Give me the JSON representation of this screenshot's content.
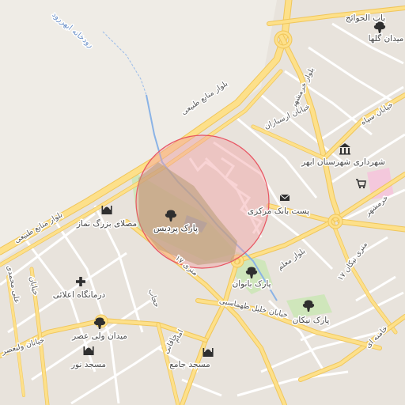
{
  "map": {
    "highlight_fill": "#f1a0a2",
    "highlight_stroke": "#e85562",
    "road_color": "#fde08a",
    "road_casing": "#f0c65a",
    "park_color": "#cfe6bb",
    "water_color": "#8ab3e6"
  },
  "places": {
    "park_pardis": "پارک پردیس",
    "park_banovan": "پارک بانوان",
    "park_neyekan": "پارک نیکان",
    "mosala": "مصلای بزرگ نماز",
    "clinic": "درمانگاه اعلائی",
    "meydan_valiasr": "میدان ولی عصر",
    "masjed_noor": "مسجد نور",
    "masjed_jame": "مسجد جامع",
    "post_bank": "پست بانک مرکزی",
    "shahrdari": "شهرداری شهرستان ابهر",
    "meydan_golha": "میدان گلها",
    "bab_havaej": "باب الحوائج"
  },
  "roads": {
    "bolvar_manabe_tabiei_1": "بلوار منابع طبیعی",
    "bolvar_manabe_tabiei_2": "بلوار منابع طبیعی",
    "rudkhaneh": "رودخانه ابهررود",
    "khorramshahr": "بلوار خرمشهر",
    "khorramshahr_2": "خرمشهر",
    "arsaran": "خیابان ارسباران",
    "sepah": "خیابان سپاه",
    "moallem": "بلوار معلم",
    "metri17_a": "۱۷ متری",
    "metri17_b": "۱۷ متری نیکان",
    "tohamasbi": "خیابان خلیل طهماسبی",
    "khamenei": "خامنه ای",
    "hejab": "حجاب",
    "emam": "امام",
    "khiaban_valiasr": "خیابان ولیعصر",
    "ali_mahmudi": "علی محمدی",
    "khiaban_parvin": "خیابان",
    "khaghani": "خاقانی"
  },
  "icons": {
    "tree": "tree-icon",
    "mosque": "mosque-icon",
    "clinic": "plus-icon",
    "bank": "envelope-icon",
    "government": "building-icon",
    "mall": "cart-icon"
  }
}
